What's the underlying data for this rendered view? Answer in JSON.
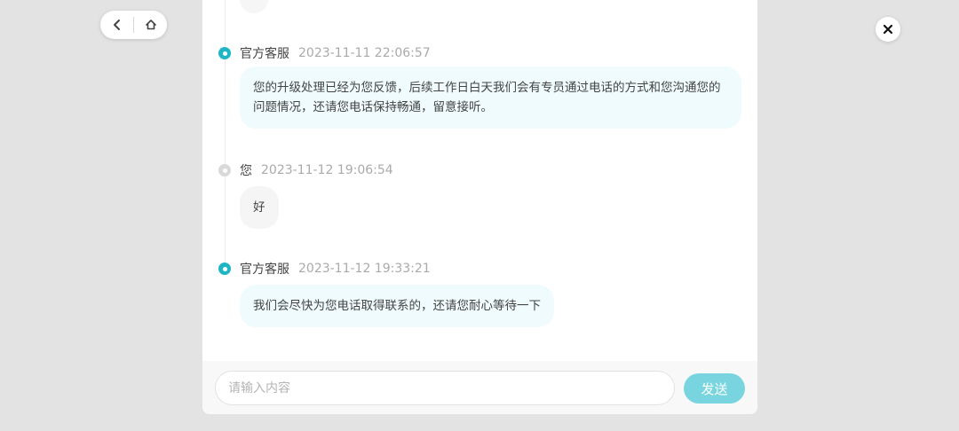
{
  "nav": {
    "back_icon": "chevron-left-icon",
    "home_icon": "home-icon"
  },
  "close": {
    "icon": "close-icon"
  },
  "messages": [
    {
      "sender": "官方客服",
      "role": "agent",
      "time": "2023-11-11 22:06:57",
      "text": "您的升级处理已经为您反馈，后续工作日白天我们会有专员通过电话的方式和您沟通您的问题情况，还请您电话保持畅通，留意接听。"
    },
    {
      "sender": "您",
      "role": "user",
      "time": "2023-11-12 19:06:54",
      "text": "好"
    },
    {
      "sender": "官方客服",
      "role": "agent",
      "time": "2023-11-12 19:33:21",
      "text": "我们会尽快为您电话取得联系的，还请您耐心等待一下"
    }
  ],
  "composer": {
    "placeholder": "请输入内容",
    "value": "",
    "send_label": "发送"
  },
  "colors": {
    "accent": "#1eb5c5",
    "send_button": "#78d5df",
    "agent_bubble": "#effbfd",
    "user_bubble": "#f5f5f5"
  }
}
